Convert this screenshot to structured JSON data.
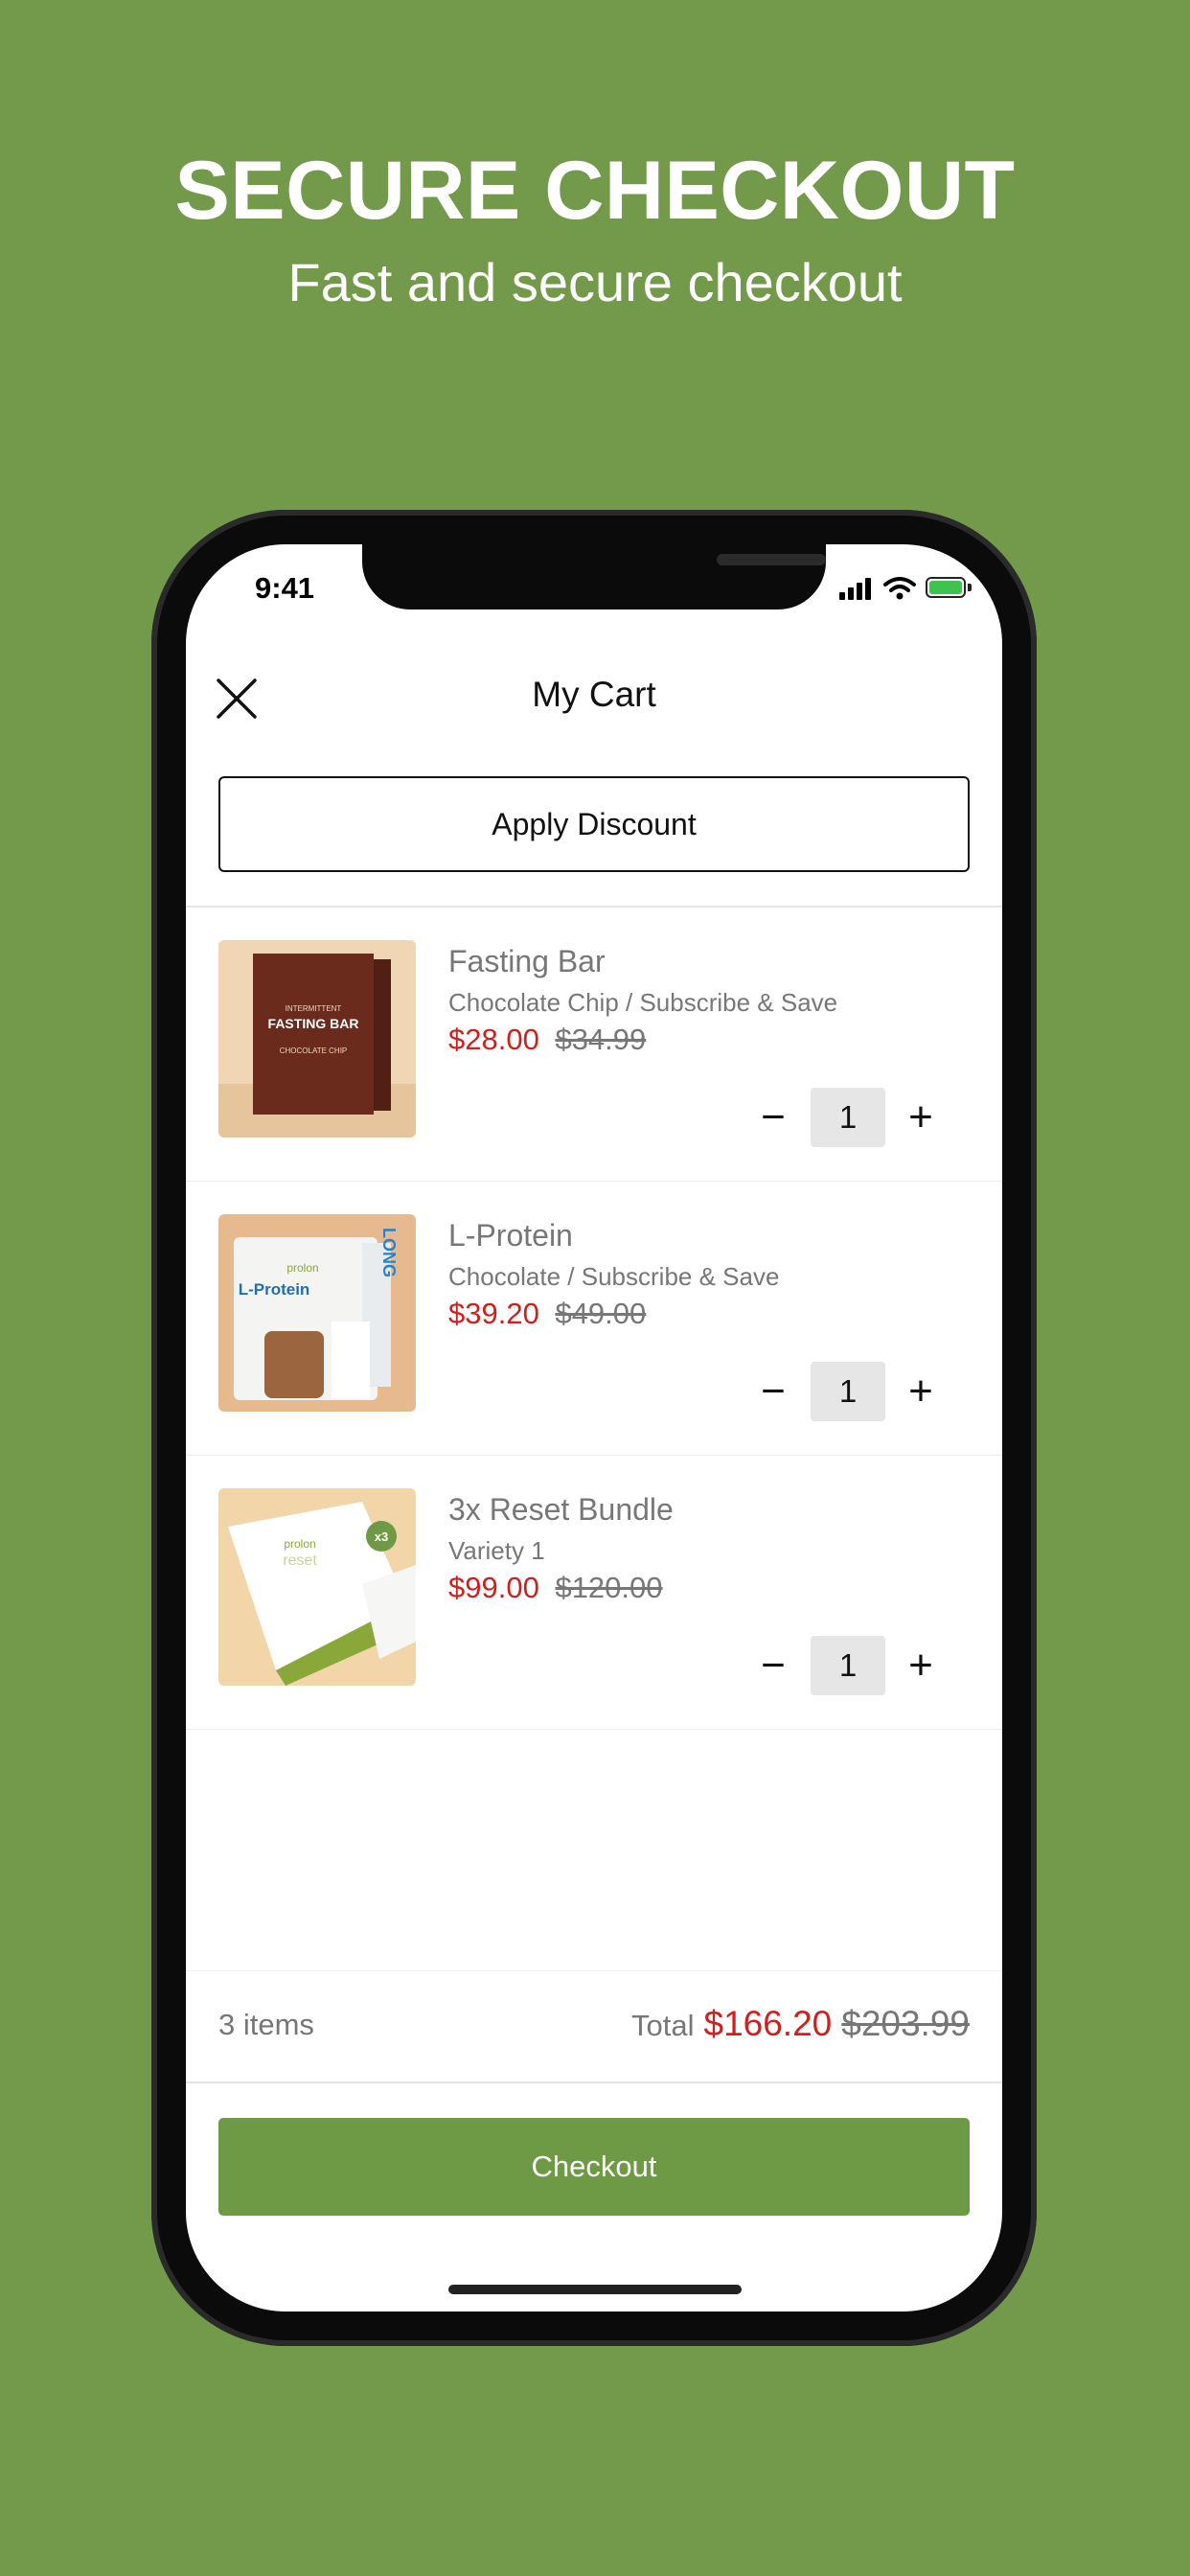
{
  "hero": {
    "title": "SECURE CHECKOUT",
    "subtitle": "Fast and secure checkout"
  },
  "status_bar": {
    "time": "9:41",
    "icons": [
      "signal-icon",
      "wifi-icon",
      "battery-icon"
    ]
  },
  "header": {
    "title": "My Cart",
    "close_icon": "close-icon"
  },
  "discount": {
    "label": "Apply Discount"
  },
  "items": [
    {
      "name": "Fasting Bar",
      "variant": "Chocolate Chip / Subscribe & Save",
      "price": "$28.00",
      "compare_price": "$34.99",
      "quantity": "1",
      "image": "fasting-bar-product-image",
      "image_text": [
        "INTERMITTENT",
        "FASTING BAR",
        "CHOCOLATE CHIP"
      ]
    },
    {
      "name": "L-Protein",
      "variant": "Chocolate / Subscribe & Save",
      "price": "$39.20",
      "compare_price": "$49.00",
      "quantity": "1",
      "image": "l-protein-product-image",
      "image_text": [
        "prolon",
        "L-Protein",
        "LONG"
      ]
    },
    {
      "name": "3x Reset Bundle",
      "variant": "Variety 1",
      "price": "$99.00",
      "compare_price": "$120.00",
      "quantity": "1",
      "image": "reset-bundle-product-image",
      "image_text": [
        "prolon",
        "reset",
        "x3"
      ]
    }
  ],
  "quantity_controls": {
    "minus": "−",
    "plus": "+"
  },
  "summary": {
    "items_count": "3 items",
    "total_label": "Total",
    "total_price": "$166.20",
    "total_compare": "$203.99"
  },
  "checkout": {
    "label": "Checkout"
  },
  "colors": {
    "background": "#739a4a",
    "accent_green": "#6f9a45",
    "sale_red": "#d0201e",
    "muted_text": "#777777"
  }
}
